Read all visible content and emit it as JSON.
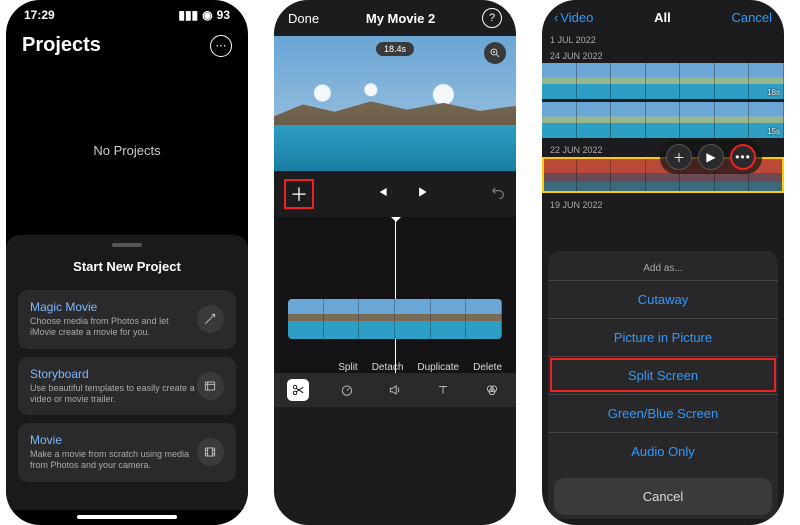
{
  "status": {
    "time": "17:29",
    "battery": "93"
  },
  "phone1": {
    "title": "Projects",
    "empty": "No Projects",
    "drawer_title": "Start New Project",
    "cards": [
      {
        "title": "Magic Movie",
        "desc": "Choose media from Photos and let iMovie create a movie for you."
      },
      {
        "title": "Storyboard",
        "desc": "Use beautiful templates to easily create a video or movie trailer."
      },
      {
        "title": "Movie",
        "desc": "Make a movie from scratch using media from Photos and your camera."
      }
    ]
  },
  "phone2": {
    "done": "Done",
    "title": "My Movie 2",
    "duration_badge": "18.4s",
    "clip_actions": [
      "Split",
      "Detach",
      "Duplicate",
      "Delete"
    ]
  },
  "phone3": {
    "back": "Video",
    "segment": "All",
    "cancel": "Cancel",
    "sections": [
      {
        "label": "1 JUL 2022",
        "clips": []
      },
      {
        "label": "24 JUN 2022",
        "clips": [
          {
            "dur": "18s"
          },
          {
            "dur": "15s"
          }
        ]
      },
      {
        "label": "22 JUN 2022",
        "clips": [
          {
            "dur": ""
          }
        ]
      },
      {
        "label": "19 JUN 2022",
        "clips": []
      }
    ],
    "sheet": {
      "header": "Add as...",
      "options": [
        "Cutaway",
        "Picture in Picture",
        "Split Screen",
        "Green/Blue Screen",
        "Audio Only"
      ],
      "highlight_index": 2,
      "cancel": "Cancel"
    }
  }
}
